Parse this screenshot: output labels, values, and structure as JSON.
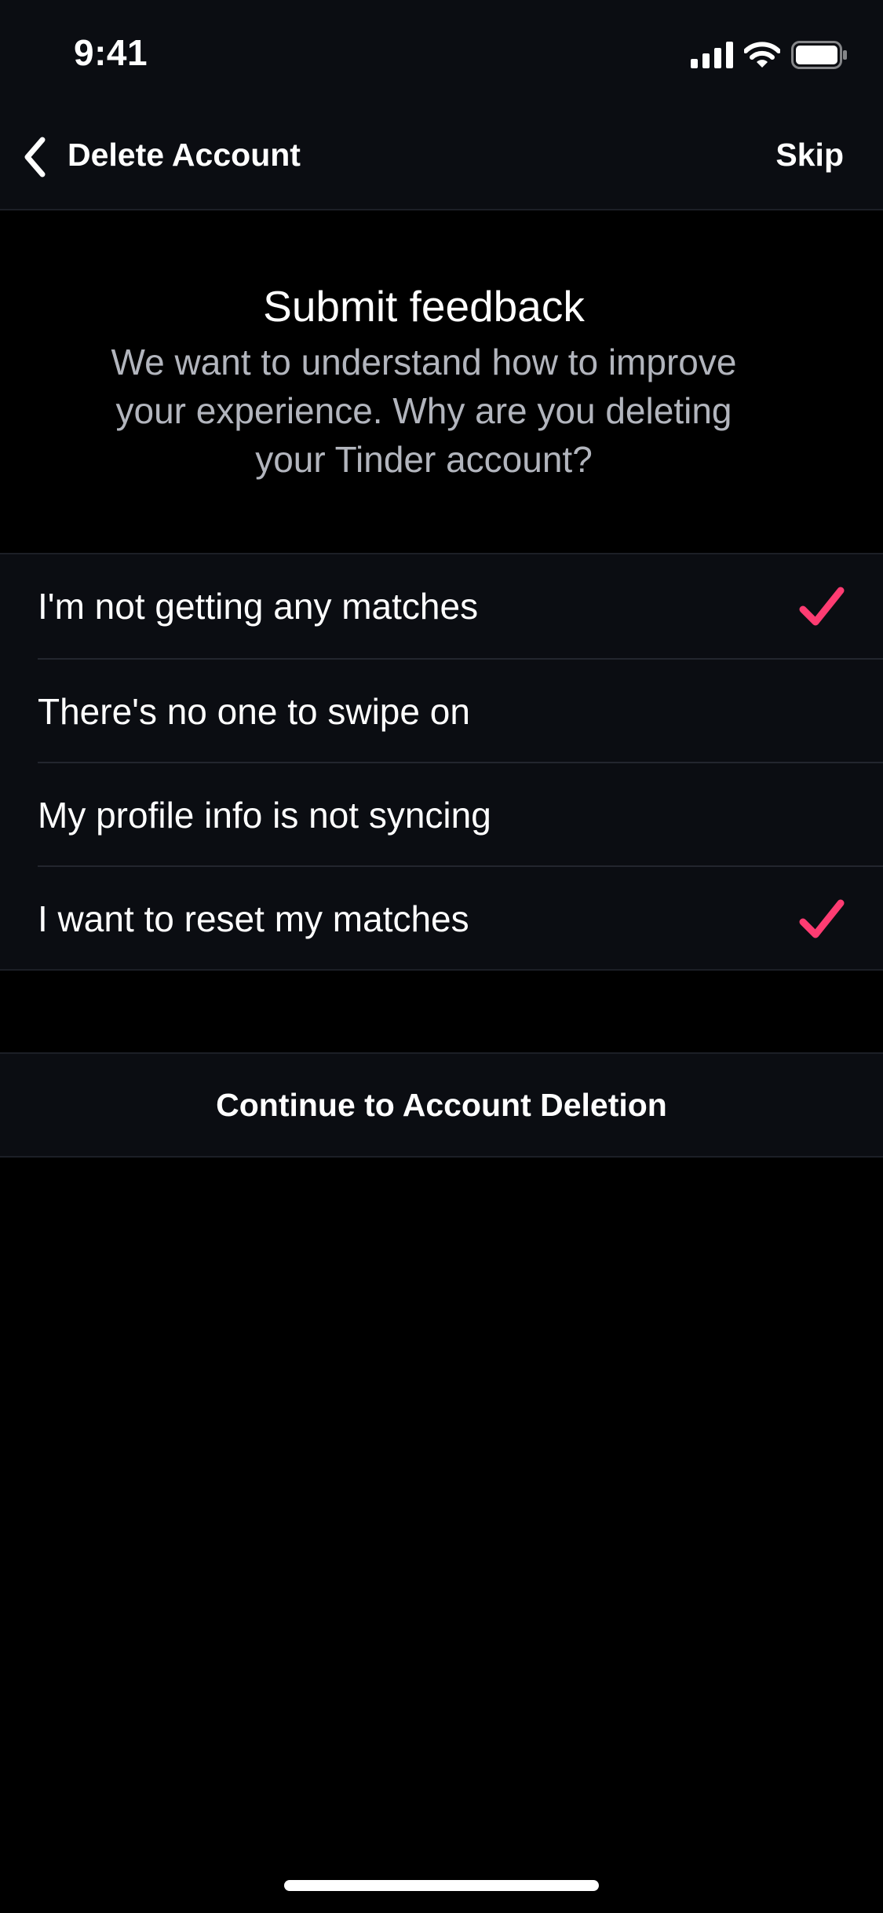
{
  "status_bar": {
    "time": "9:41",
    "icons": [
      "signal-icon",
      "wifi-icon",
      "battery-icon"
    ]
  },
  "nav": {
    "back_icon": "chevron-left-icon",
    "title": "Delete Account",
    "skip_label": "Skip"
  },
  "header": {
    "title": "Submit feedback",
    "subtitle": "We want to understand how to improve your experience. Why are you deleting your Tinder account?"
  },
  "options": [
    {
      "label": "I'm not getting any matches",
      "selected": true
    },
    {
      "label": "There's no one to swipe on",
      "selected": false
    },
    {
      "label": "My profile info is not syncing",
      "selected": false
    },
    {
      "label": "I want to reset my matches",
      "selected": true
    }
  ],
  "continue_label": "Continue to Account Deletion",
  "colors": {
    "accent": "#fe3c72",
    "background": "#000000",
    "surface": "#0b0d12"
  }
}
